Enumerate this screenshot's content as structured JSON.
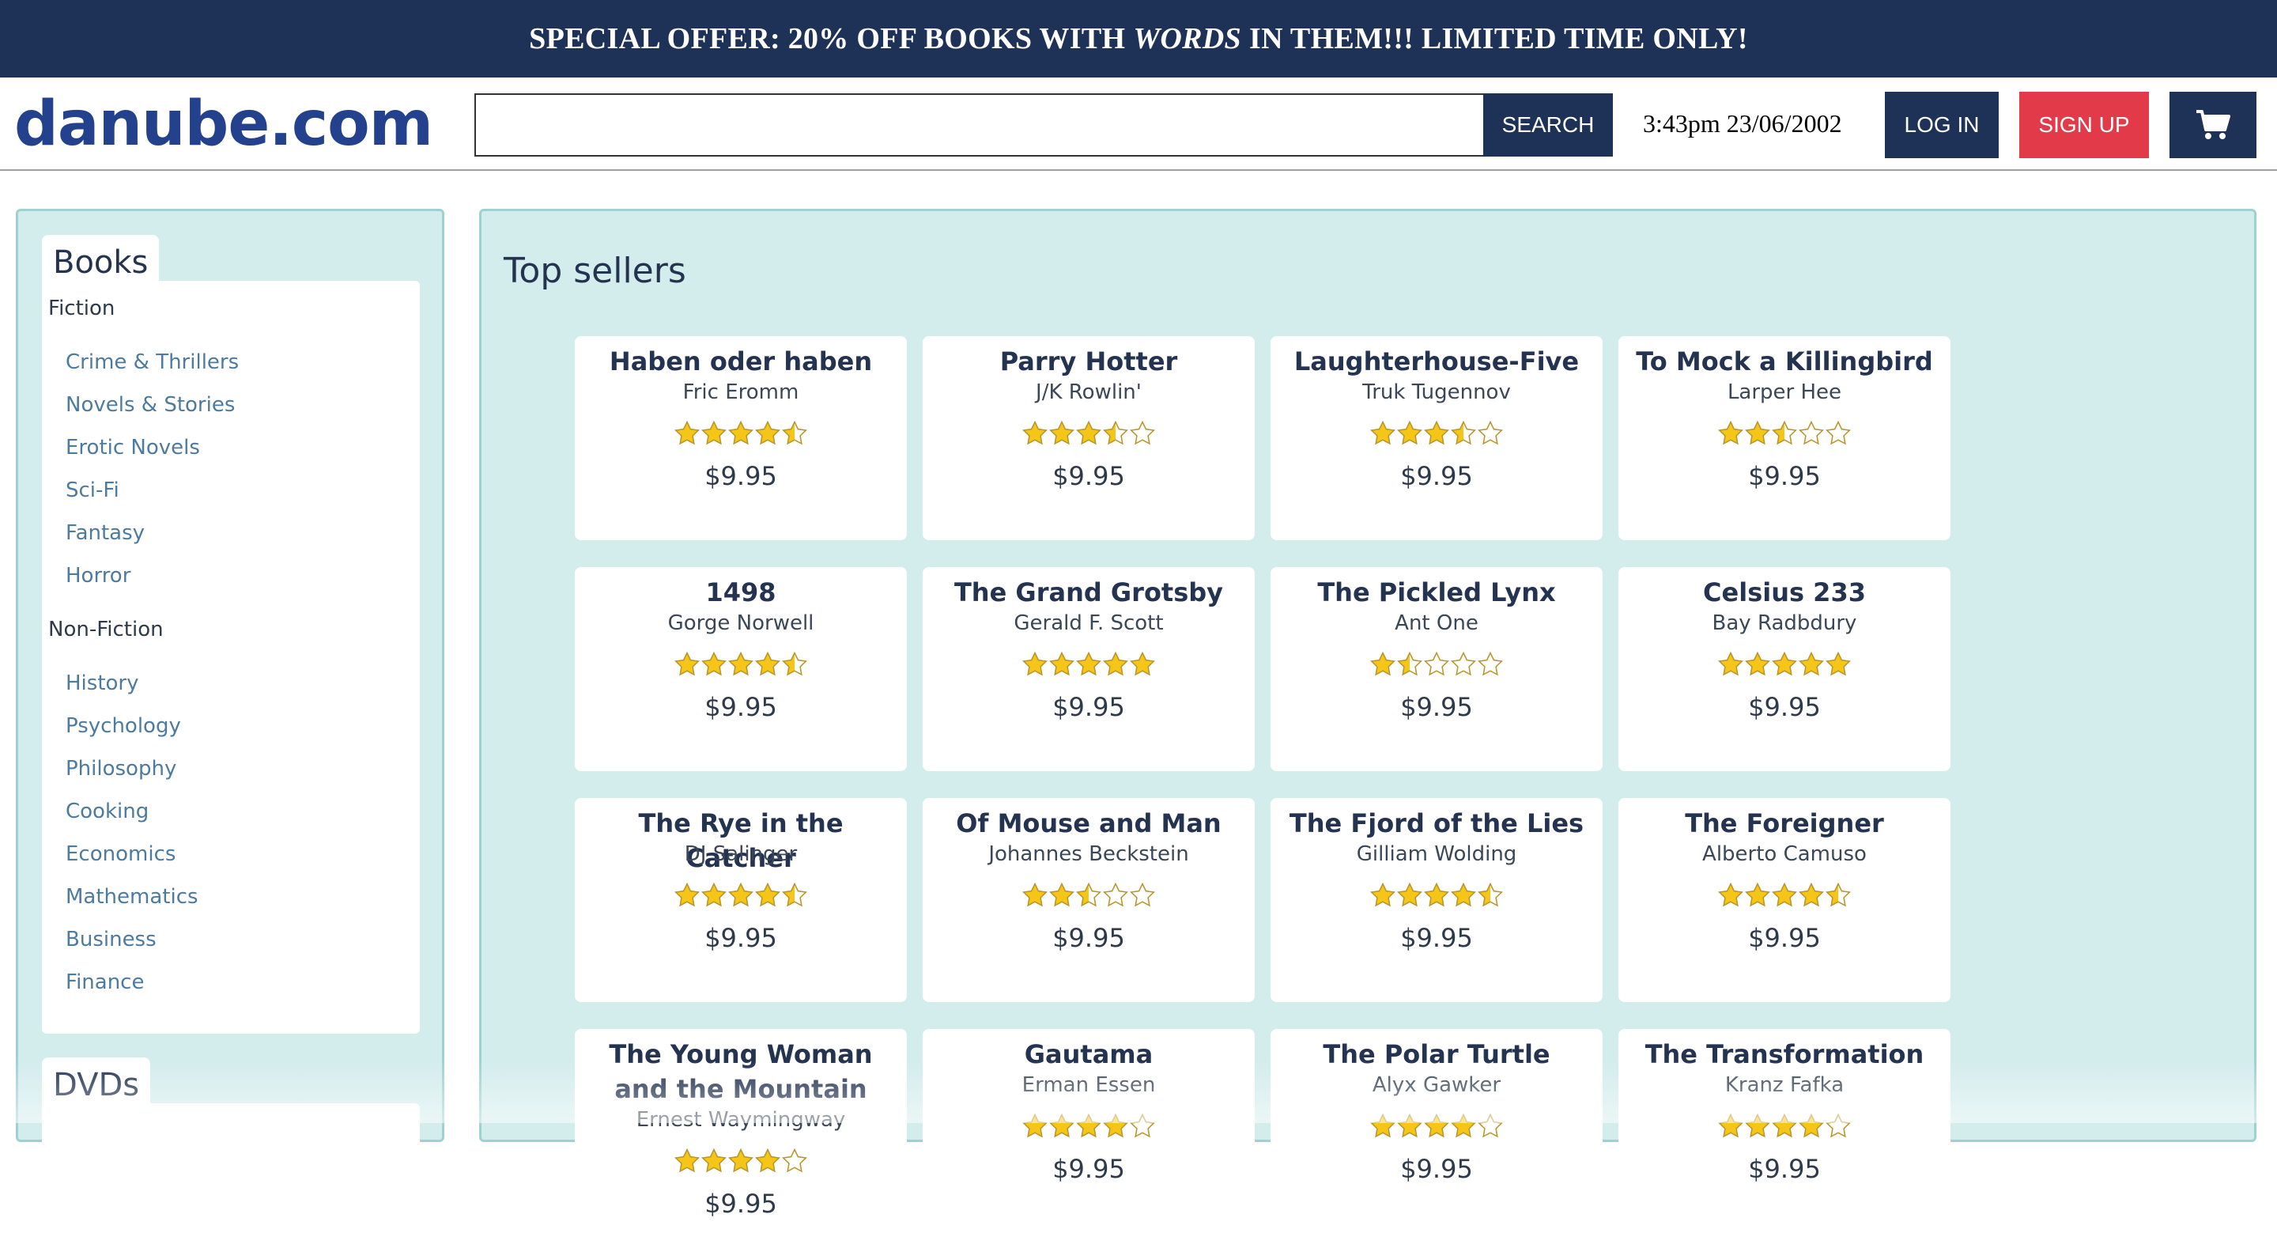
{
  "promo": {
    "before": "SPECIAL OFFER: 20% OFF BOOKS WITH",
    "emphasis": "WORDS",
    "after": "IN THEM!!! LIMITED TIME ONLY!"
  },
  "header": {
    "logo": "danube.com",
    "search_placeholder": "",
    "search_label": "SEARCH",
    "clock": "3:43pm 23/06/2002",
    "login_label": "LOG IN",
    "signup_label": "SIGN UP",
    "cart_icon": "cart-icon"
  },
  "sidebar": {
    "sections": [
      {
        "tab": "Books",
        "groups": [
          {
            "name": "Fiction",
            "items": [
              "Crime & Thrillers",
              "Novels & Stories",
              "Erotic Novels",
              "Sci-Fi",
              "Fantasy",
              "Horror"
            ]
          },
          {
            "name": "Non-Fiction",
            "items": [
              "History",
              "Psychology",
              "Philosophy",
              "Cooking",
              "Economics",
              "Mathematics",
              "Business",
              "Finance"
            ]
          }
        ]
      },
      {
        "tab": "DVDs",
        "groups": []
      }
    ]
  },
  "main": {
    "title": "Top sellers",
    "books": [
      {
        "title": "Haben oder haben",
        "author": "Fric Eromm",
        "rating": 4.5,
        "price": "$9.95"
      },
      {
        "title": "Parry Hotter",
        "author": "J/K Rowlin'",
        "rating": 3.5,
        "price": "$9.95"
      },
      {
        "title": "Laughterhouse-Five",
        "author": "Truk Tugennov",
        "rating": 3.5,
        "price": "$9.95"
      },
      {
        "title": "To Mock a Killingbird",
        "author": "Larper Hee",
        "rating": 2.5,
        "price": "$9.95"
      },
      {
        "title": "1498",
        "author": "Gorge Norwell",
        "rating": 4.5,
        "price": "$9.95"
      },
      {
        "title": "The Grand Grotsby",
        "author": "Gerald F. Scott",
        "rating": 5,
        "price": "$9.95"
      },
      {
        "title": "The Pickled Lynx",
        "author": "Ant One",
        "rating": 1.5,
        "price": "$9.95"
      },
      {
        "title": "Celsius 233",
        "author": "Bay Radbdury",
        "rating": 5,
        "price": "$9.95"
      },
      {
        "title": "The Rye in the Catcher",
        "author": "DJ Salinger",
        "rating": 4.5,
        "price": "$9.95"
      },
      {
        "title": "Of Mouse and Man",
        "author": "Johannes Beckstein",
        "rating": 2.5,
        "price": "$9.95"
      },
      {
        "title": "The Fjord of the Lies",
        "author": "Gilliam Wolding",
        "rating": 4.5,
        "price": "$9.95"
      },
      {
        "title": "The Foreigner",
        "author": "Alberto Camuso",
        "rating": 4.5,
        "price": "$9.95"
      },
      {
        "title": "The Young Woman and the Mountain",
        "author": "Ernest Waymingway",
        "rating": 4,
        "price": "$9.95"
      },
      {
        "title": "Gautama",
        "author": "Erman Essen",
        "rating": 4,
        "price": "$9.95"
      },
      {
        "title": "The Polar Turtle",
        "author": "Alyx Gawker",
        "rating": 4,
        "price": "$9.95"
      },
      {
        "title": "The Transformation",
        "author": "Kranz Fafka",
        "rating": 4,
        "price": "$9.95"
      }
    ]
  },
  "colors": {
    "navy": "#1e3258",
    "signup_red": "#e23a48",
    "panel_bg": "#d3ecec",
    "star_gold": "#f5c518",
    "link_blue": "#4d7ba0"
  }
}
